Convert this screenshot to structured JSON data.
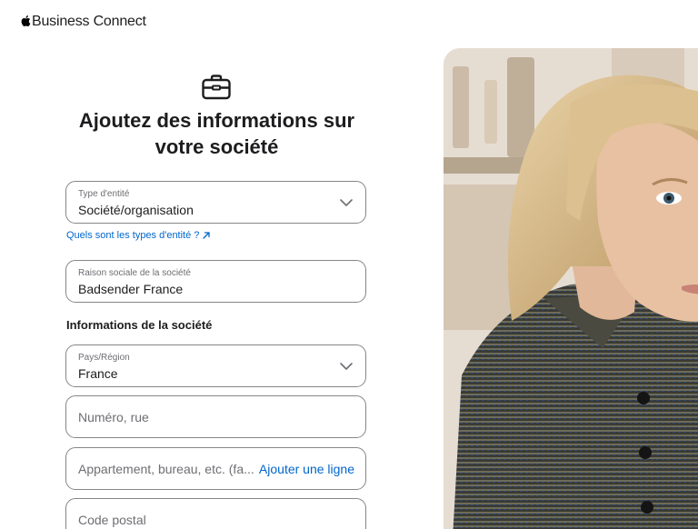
{
  "brand": {
    "name": "Business Connect"
  },
  "heading": "Ajoutez des informations sur votre société",
  "entity_type": {
    "label": "Type d'entité",
    "value": "Société/organisation"
  },
  "entity_help_link": "Quels sont les types d'entité ?",
  "company_name": {
    "label": "Raison sociale de la société",
    "value": "Badsender France"
  },
  "section_title": "Informations de la société",
  "country": {
    "label": "Pays/Région",
    "value": "France"
  },
  "street": {
    "placeholder": "Numéro, rue"
  },
  "apartment": {
    "placeholder": "Appartement, bureau, etc. (fa...",
    "add_line": "Ajouter une ligne"
  },
  "postal_code": {
    "placeholder": "Code postal"
  }
}
